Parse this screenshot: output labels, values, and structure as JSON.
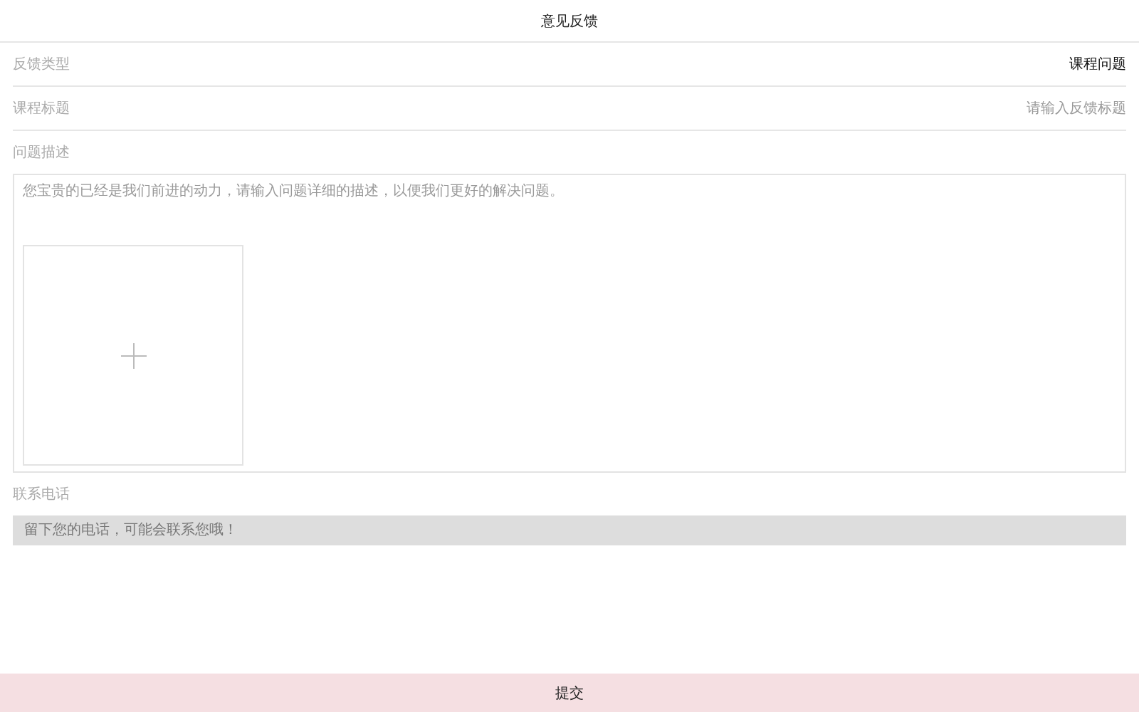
{
  "header": {
    "title": "意见反馈"
  },
  "rows": [
    {
      "label": "反馈类型",
      "value": "课程问题"
    },
    {
      "label": "课程标题",
      "placeholder": "请输入反馈标题"
    }
  ],
  "description": {
    "label": "问题描述",
    "placeholder": "您宝贵的已经是我们前进的动力，请输入问题详细的描述，以便我们更好的解决问题。"
  },
  "phone": {
    "label": "联系电话",
    "placeholder": "留下您的电话，可能会联系您哦！"
  },
  "submit": {
    "label": "提交"
  }
}
